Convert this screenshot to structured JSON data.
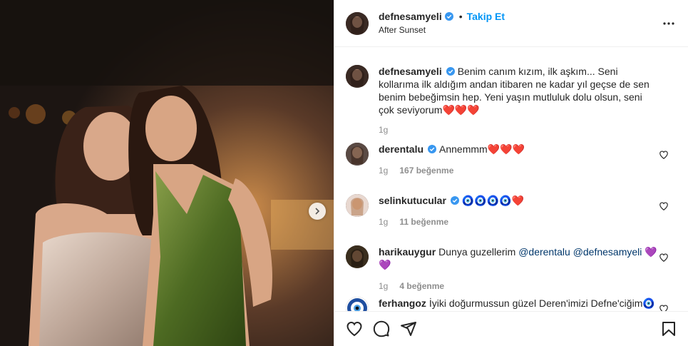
{
  "post": {
    "username": "defnesamyeli",
    "follow_label": "Takip Et",
    "separator": "•",
    "location": "After Sunset",
    "caption": "Benim canım kızım, ilk aşkım... Seni kollarıma ilk aldığım andan itibaren ne kadar yıl geçse de sen benim bebeğimsin hep. Yeni yaşın mutluluk dolu olsun, seni çok seviyorum",
    "caption_emoji": "❤️❤️❤️",
    "caption_time": "1g"
  },
  "comments": [
    {
      "username": "derentalu",
      "verified": true,
      "text": "Annemmm",
      "emoji": "❤️❤️❤️",
      "time": "1g",
      "likes": "167 beğenme"
    },
    {
      "username": "selinkutucular",
      "verified": true,
      "text": "",
      "emoji": "🧿🧿🧿🧿❤️",
      "time": "1g",
      "likes": "11 beğenme"
    },
    {
      "username": "harikauygur",
      "verified": false,
      "text": "Dunya guzellerim",
      "mention1": "@derentalu",
      "mention2": "@defnesamyeli",
      "emoji": "💜💜",
      "time": "1g",
      "likes": "4 beğenme"
    },
    {
      "username": "ferhangoz",
      "verified": false,
      "text": "İyiki doğurmussun güzel Deren'imizi Defne'ciğim",
      "emoji": "🧿💙"
    }
  ],
  "icons": {
    "verified": "verified-badge-icon",
    "more": "more-options-icon",
    "like": "heart-icon",
    "comment": "comment-icon",
    "share": "share-icon",
    "save": "bookmark-icon",
    "next": "chevron-right-icon"
  },
  "colors": {
    "accent": "#0095f6",
    "verified": "#3897f0",
    "meta": "#8e8e8e",
    "border": "#efefef"
  }
}
